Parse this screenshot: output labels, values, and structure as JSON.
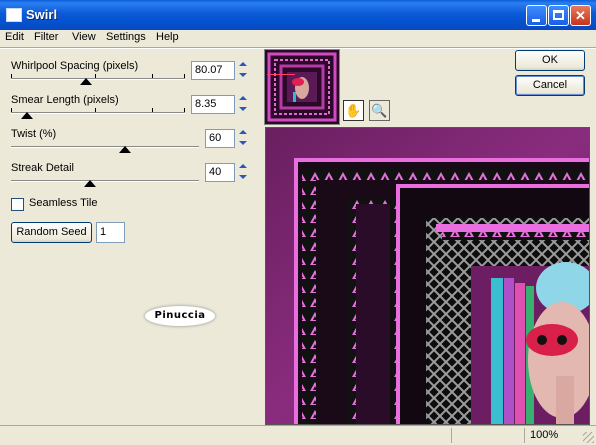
{
  "window": {
    "title": "Swirl"
  },
  "menu": [
    "Edit",
    "Filter",
    "View",
    "Settings",
    "Help"
  ],
  "controls": {
    "whirlpool_spacing": {
      "label": "Whirlpool Spacing (pixels)",
      "value": "80.07"
    },
    "smear_length": {
      "label": "Smear Length (pixels)",
      "value": "8.35"
    },
    "twist": {
      "label": "Twist (%)",
      "value": "60"
    },
    "streak_detail": {
      "label": "Streak Detail",
      "value": "40"
    },
    "seamless_tile": {
      "label": "Seamless Tile",
      "checked": false
    },
    "random_seed": {
      "button_label": "Random Seed",
      "value": "1"
    }
  },
  "buttons": {
    "ok": "OK",
    "cancel": "Cancel"
  },
  "watermark": "Pinuccia",
  "status": {
    "zoom": "100%"
  },
  "colors": {
    "titlebar": "#0a5fd9",
    "preview_magenta": "#e040d0",
    "preview_dark": "#1a0a18"
  },
  "icons": {
    "hand": "hand-pan-icon",
    "zoom": "magnifier-icon"
  }
}
